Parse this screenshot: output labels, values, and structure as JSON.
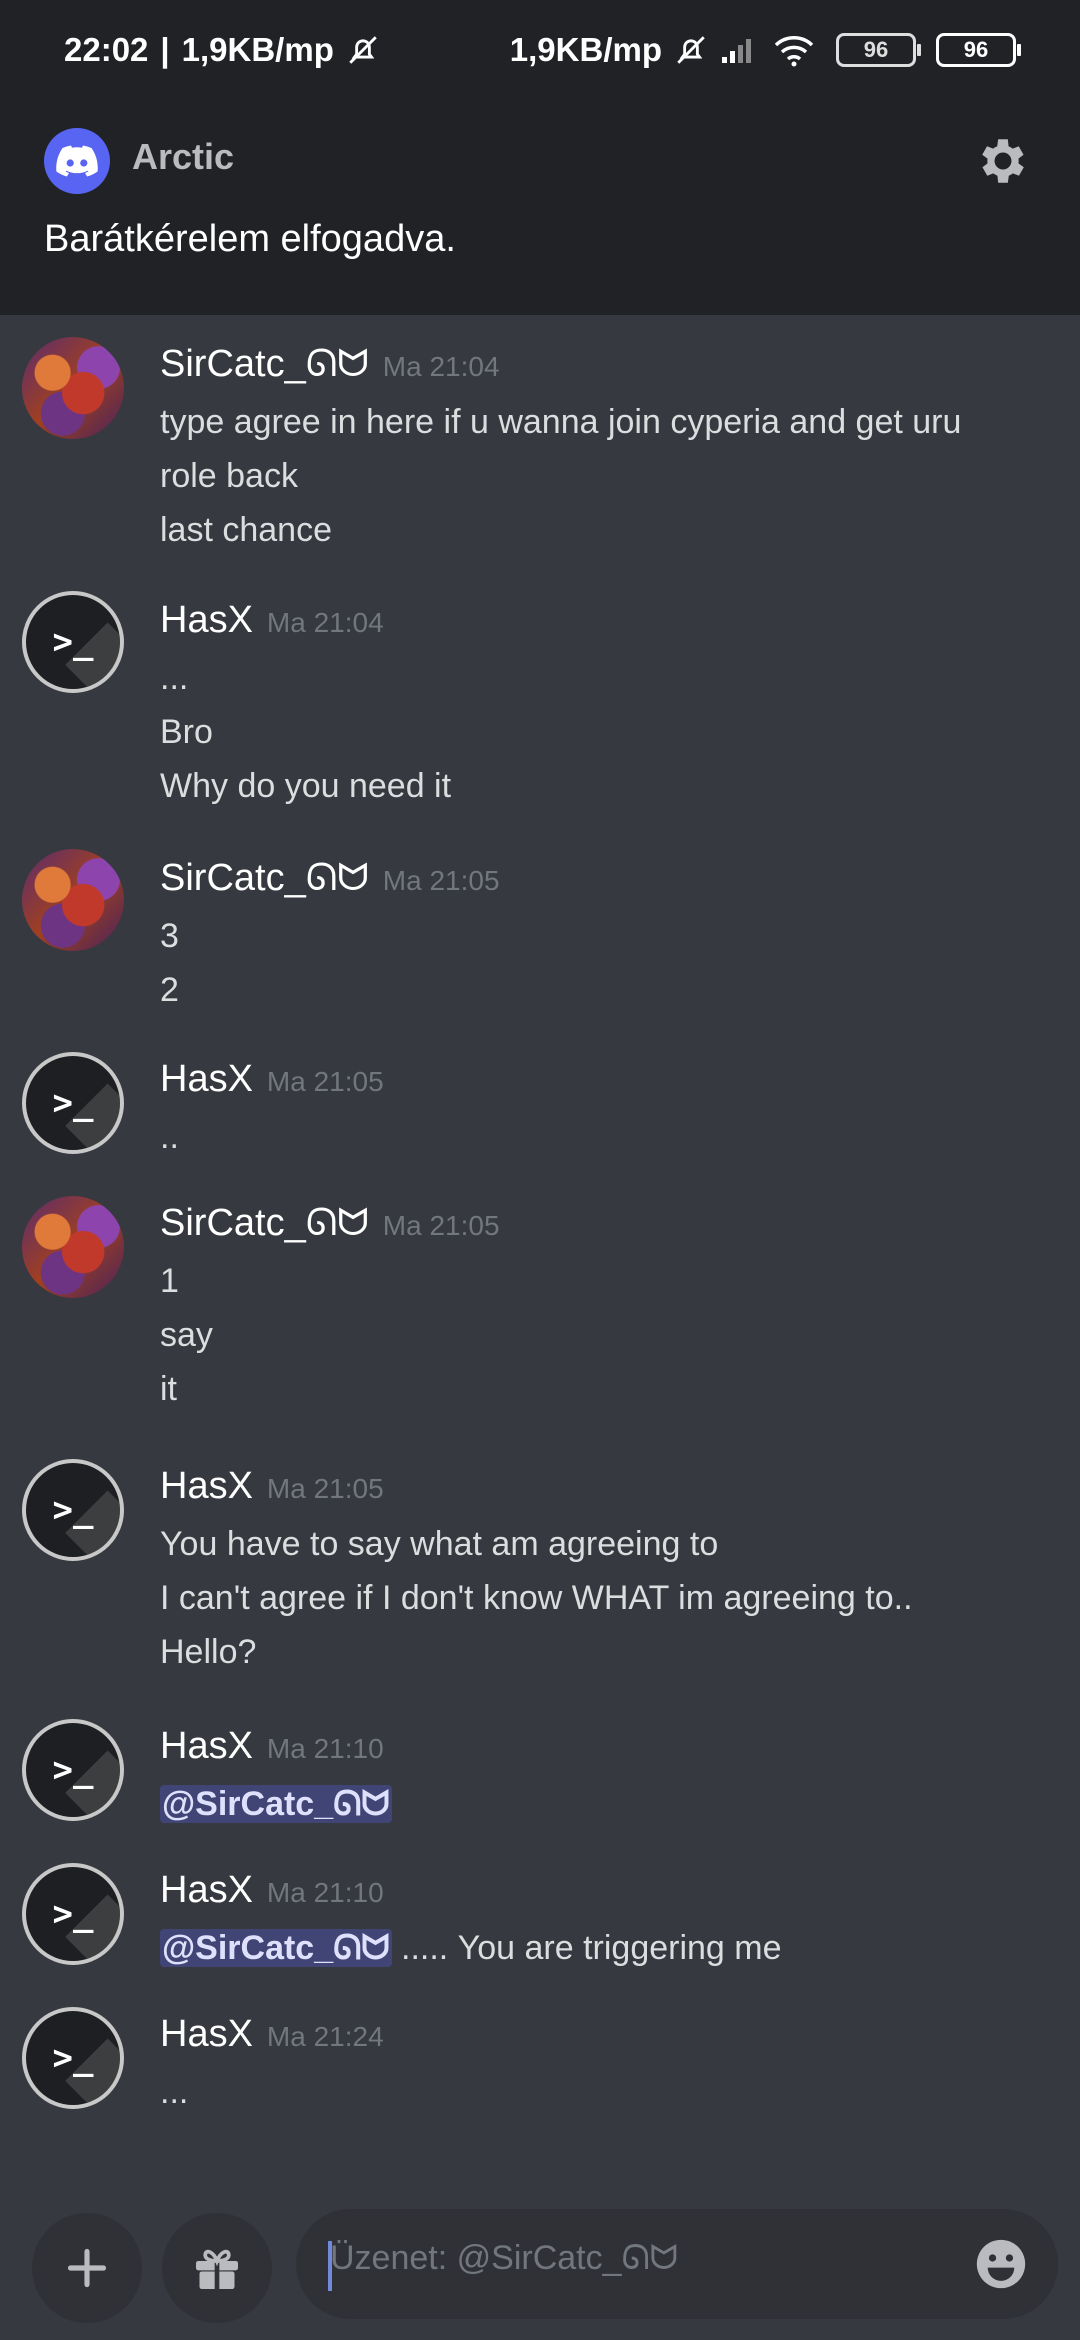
{
  "status_bar": {
    "time": "22:02",
    "separator": "|",
    "speed_left": "1,9KB/mp",
    "speed_right": "1,9KB/mp",
    "battery_outline": "96",
    "battery": "96"
  },
  "header": {
    "app_name": "Arctic",
    "notice": "Barátkérelem elfogadva."
  },
  "messages": [
    {
      "author": "SirCatc_ᘏᗢ",
      "time": "Ma 21:04",
      "avatar": "cat-avatar",
      "lines": [
        "type agree in here if u wanna join cyperia and get uru",
        "role back",
        "last chance"
      ]
    },
    {
      "author": "HasX",
      "time": "Ma 21:04",
      "avatar": "terminal-avatar",
      "lines": [
        "...",
        "Bro",
        "Why do you need it"
      ]
    },
    {
      "author": "SirCatc_ᘏᗢ",
      "time": "Ma 21:05",
      "avatar": "cat-avatar",
      "lines": [
        "3",
        "2"
      ]
    },
    {
      "author": "HasX",
      "time": "Ma 21:05",
      "avatar": "terminal-avatar",
      "lines": [
        ".."
      ]
    },
    {
      "author": "SirCatc_ᘏᗢ",
      "time": "Ma 21:05",
      "avatar": "cat-avatar",
      "lines": [
        "1",
        "say",
        "it"
      ]
    },
    {
      "author": "HasX",
      "time": "Ma 21:05",
      "avatar": "terminal-avatar",
      "lines": [
        "You have to say what am agreeing to",
        "I can't agree if I don't know WHAT im agreeing to..",
        "Hello?"
      ]
    },
    {
      "author": "HasX",
      "time": "Ma 21:10",
      "avatar": "terminal-avatar",
      "mention": "@SirCatc_ᘏᗢ",
      "mention_suffix": ""
    },
    {
      "author": "HasX",
      "time": "Ma 21:10",
      "avatar": "terminal-avatar",
      "mention": "@SirCatc_ᘏᗢ",
      "mention_suffix": " ..... You are triggering me"
    },
    {
      "author": "HasX",
      "time": "Ma 21:24",
      "avatar": "terminal-avatar",
      "lines": [
        "..."
      ]
    }
  ],
  "composer": {
    "placeholder": "Üzenet: @SirCatc_ᘏᗢ"
  },
  "colors": {
    "background": "#36393f",
    "header": "#202225",
    "blurple": "#5865f2",
    "mention_bg": "#4a5088"
  }
}
